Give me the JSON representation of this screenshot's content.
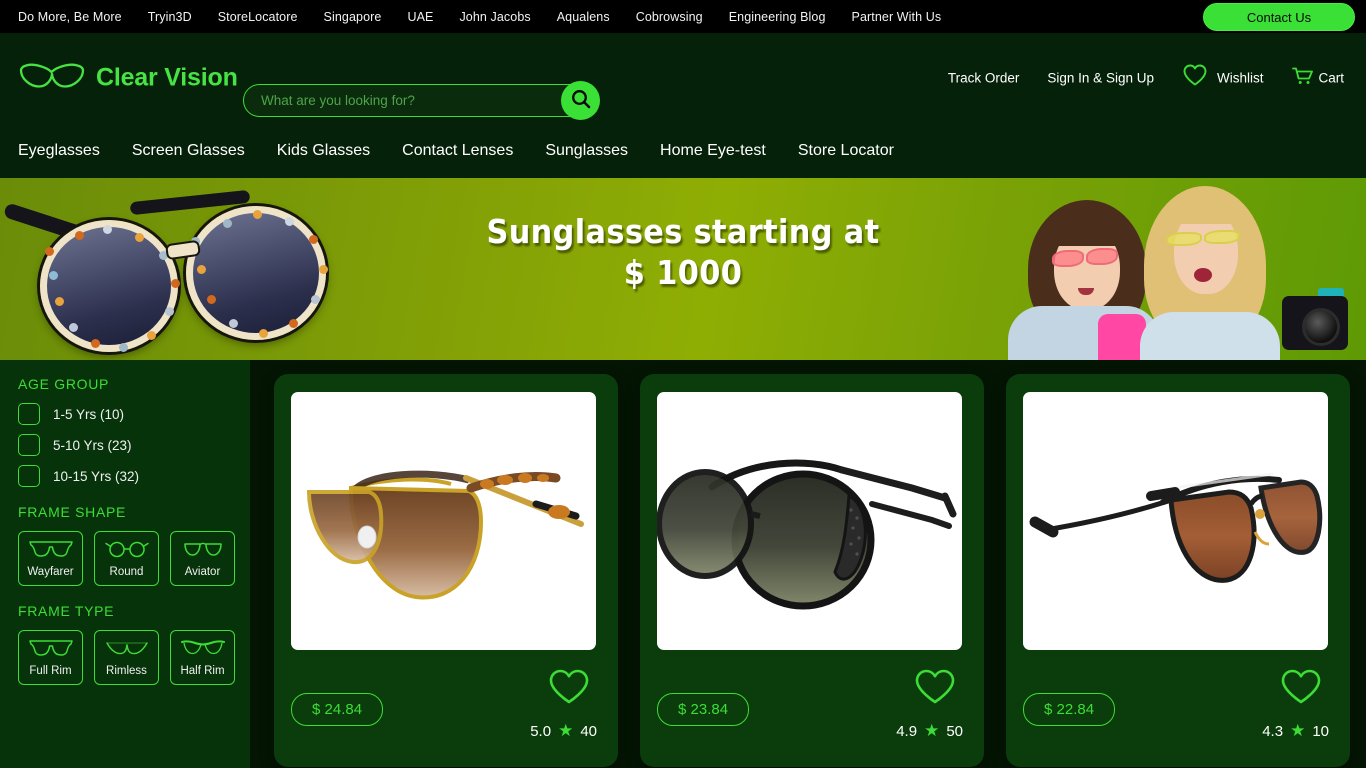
{
  "topbar": {
    "links": [
      "Do More, Be More",
      "Tryin3D",
      "StoreLocatore",
      "Singapore",
      "UAE",
      "John Jacobs",
      "Aqualens",
      "Cobrowsing",
      "Engineering Blog",
      "Partner With Us"
    ],
    "contact_button": "Contact Us"
  },
  "header": {
    "brand": "Clear Vision",
    "search_placeholder": "What are you looking for?",
    "search_value": "",
    "track_order": "Track Order",
    "sign_in": "Sign In & Sign Up",
    "wishlist": "Wishlist",
    "cart": "Cart"
  },
  "mainnav": {
    "items": [
      "Eyeglasses",
      "Screen Glasses",
      "Kids Glasses",
      "Contact Lenses",
      "Sunglasses",
      "Home Eye-test",
      "Store Locator"
    ]
  },
  "hero": {
    "line1": "Sunglasses starting at",
    "line2": "$ 1000"
  },
  "filters": {
    "age_group": {
      "title": "AGE GROUP",
      "options": [
        {
          "label": "1-5  Yrs (10)",
          "checked": false
        },
        {
          "label": "5-10  Yrs (23)",
          "checked": false
        },
        {
          "label": "10-15  Yrs (32)",
          "checked": false
        }
      ]
    },
    "frame_shape": {
      "title": "FRAME SHAPE",
      "options": [
        {
          "label": "Wayfarer",
          "icon": "wayfarer-glasses-icon"
        },
        {
          "label": "Round",
          "icon": "round-glasses-icon"
        },
        {
          "label": "Aviator",
          "icon": "aviator-glasses-icon"
        }
      ]
    },
    "frame_type": {
      "title": "FRAME TYPE",
      "options": [
        {
          "label": "Full Rim",
          "icon": "full-rim-glasses-icon"
        },
        {
          "label": "Rimless",
          "icon": "rimless-glasses-icon"
        },
        {
          "label": "Half Rim",
          "icon": "half-rim-glasses-icon"
        }
      ]
    }
  },
  "products": [
    {
      "price": "$ 24.84",
      "rating": "5.0",
      "reviews": "40",
      "image": "gold-aviator-brown-gradient-sunglasses"
    },
    {
      "price": "$ 23.84",
      "rating": "4.9",
      "reviews": "50",
      "image": "black-round-side-shield-sunglasses"
    },
    {
      "price": "$ 22.84",
      "rating": "4.3",
      "reviews": "10",
      "image": "black-aviator-copper-mirror-sunglasses"
    }
  ],
  "colors": {
    "accent_green": "#3ddc36",
    "brand_green": "#47e243",
    "header_bg": "#06210a",
    "page_bg": "#041504",
    "sidebar_bg": "#07330b",
    "card_bg": "#0a3d0b",
    "hero_olive": "#8fae04"
  }
}
